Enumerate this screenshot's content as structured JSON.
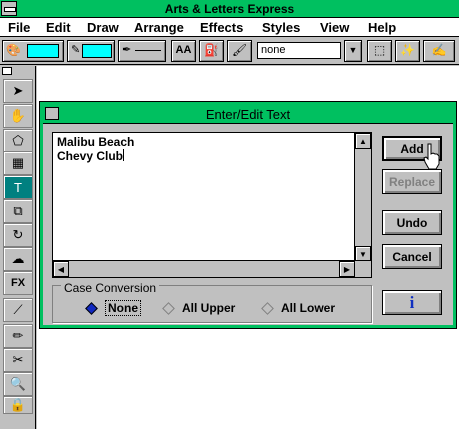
{
  "app": {
    "title": "Arts & Letters Express"
  },
  "menu": [
    "File",
    "Edit",
    "Draw",
    "Arrange",
    "Effects",
    "Styles",
    "View",
    "Help"
  ],
  "toolbar": {
    "line_style_value": "none",
    "colors": {
      "fill_swatch": "#00ffff",
      "line_swatch": "#00ffff"
    }
  },
  "dialog": {
    "title": "Enter/Edit Text",
    "text_lines": [
      "Malibu Beach",
      "Chevy Club"
    ],
    "buttons": {
      "add": "Add",
      "replace": "Replace",
      "undo": "Undo",
      "cancel": "Cancel",
      "info": "i"
    },
    "case_conversion": {
      "label": "Case Conversion",
      "options": [
        "None",
        "All Upper",
        "All Lower"
      ],
      "selected": "None"
    }
  },
  "colors": {
    "accent": "#00c060",
    "window_bg": "#c0c0c0",
    "active_tool": "#008080"
  }
}
